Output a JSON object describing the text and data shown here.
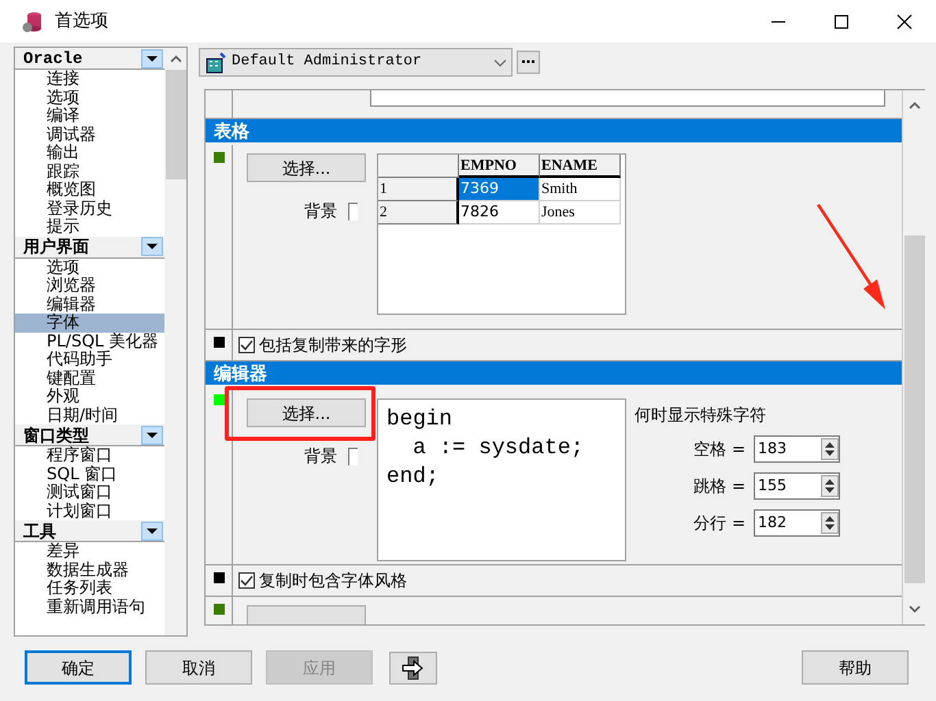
{
  "window": {
    "title": "首选项"
  },
  "sidebar": {
    "groups": [
      {
        "title": "Oracle",
        "expanded": true,
        "items": [
          {
            "label": "连接",
            "selected": false
          },
          {
            "label": "选项",
            "selected": false
          },
          {
            "label": "编译",
            "selected": false
          },
          {
            "label": "调试器",
            "selected": false
          },
          {
            "label": "输出",
            "selected": false
          },
          {
            "label": "跟踪",
            "selected": false
          },
          {
            "label": "概览图",
            "selected": false
          },
          {
            "label": "登录历史",
            "selected": false
          },
          {
            "label": "提示",
            "selected": false
          }
        ]
      },
      {
        "title": "用户界面",
        "expanded": true,
        "items": [
          {
            "label": "选项",
            "selected": false
          },
          {
            "label": "浏览器",
            "selected": false
          },
          {
            "label": "编辑器",
            "selected": false
          },
          {
            "label": "字体",
            "selected": true
          },
          {
            "label": "PL/SQL 美化器",
            "selected": false
          },
          {
            "label": "代码助手",
            "selected": false
          },
          {
            "label": "键配置",
            "selected": false
          },
          {
            "label": "外观",
            "selected": false
          },
          {
            "label": "日期/时间",
            "selected": false
          }
        ]
      },
      {
        "title": "窗口类型",
        "expanded": true,
        "items": [
          {
            "label": "程序窗口",
            "selected": false
          },
          {
            "label": "SQL 窗口",
            "selected": false
          },
          {
            "label": "测试窗口",
            "selected": false
          },
          {
            "label": "计划窗口",
            "selected": false
          }
        ]
      },
      {
        "title": "工具",
        "expanded": true,
        "items": [
          {
            "label": "差异",
            "selected": false
          },
          {
            "label": "数据生成器",
            "selected": false
          },
          {
            "label": "任务列表",
            "selected": false
          },
          {
            "label": "重新调用语句",
            "selected": false
          }
        ]
      }
    ]
  },
  "profile": {
    "value": "Default Administrator"
  },
  "sections": [
    {
      "kind": "grid",
      "title": "表格",
      "color": "#3a7d00",
      "button": "选择...",
      "background_label": "背景",
      "columns": [
        "EMPNO",
        "ENAME"
      ],
      "rows": [
        {
          "header": "1",
          "cells": [
            "7369",
            "Smith"
          ],
          "selected": true
        },
        {
          "header": "2",
          "cells": [
            "7826",
            "Jones"
          ],
          "selected": false
        }
      ]
    },
    {
      "kind": "checkbox",
      "color": "#000000",
      "label": "包括复制带来的字形",
      "checked": true
    },
    {
      "kind": "editor",
      "title": "编辑器",
      "color": "#00ff00",
      "button": "选择...",
      "background_label": "背景",
      "code": [
        "begin",
        "  a := sysdate;",
        "end;"
      ],
      "special_title": "何时显示特殊字符",
      "fields": [
        {
          "label": "空格 =",
          "value": "183"
        },
        {
          "label": "跳格 =",
          "value": "155"
        },
        {
          "label": "分行 =",
          "value": "182"
        }
      ]
    },
    {
      "kind": "checkbox",
      "color": "#000000",
      "label": "复制时包含字体风格",
      "checked": true
    },
    {
      "kind": "stub",
      "color": "#3a7d00"
    }
  ],
  "buttons": [
    {
      "kind": "default",
      "label": "确定"
    },
    {
      "kind": "normal",
      "label": "取消"
    },
    {
      "kind": "disabled",
      "label": "应用"
    },
    {
      "kind": "icon"
    },
    {
      "kind": "normal",
      "label": "帮助"
    }
  ]
}
